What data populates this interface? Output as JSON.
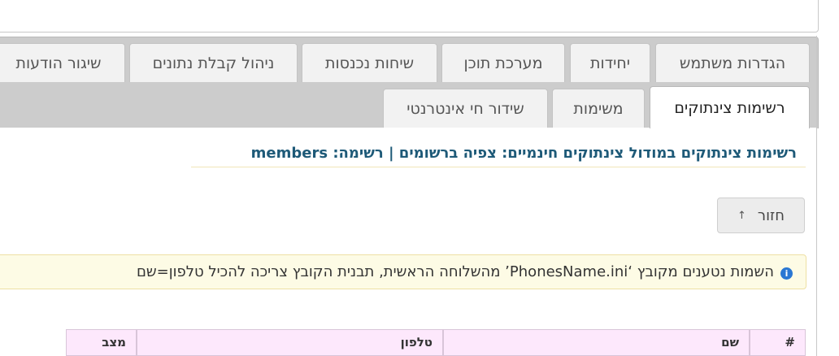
{
  "tabs_row1": [
    {
      "label": "הגדרות משתמש"
    },
    {
      "label": "יחידות"
    },
    {
      "label": "מערכת תוכן"
    },
    {
      "label": "שיחות נכנסות"
    },
    {
      "label": "ניהול קבלת נתונים"
    },
    {
      "label": "שיגור הודעות"
    }
  ],
  "tabs_row2": [
    {
      "label": "רשימות צינתוקים",
      "active": true
    },
    {
      "label": "משימות"
    },
    {
      "label": "שידור חי אינטרנטי"
    }
  ],
  "page_title": "רשימות צינתוקים במודול צינתוקים חינמיים: צפיה ברשומים | רשימה: members",
  "back_button": {
    "label": "חזור",
    "icon": "arrow-up-icon"
  },
  "alert": {
    "icon": "info-icon",
    "text": "השמות נטענים מקובץ ‘PhonesName.ini’ מהשלוחה הראשית, תבנית הקובץ צריכה להכיל טלפון=שם"
  },
  "table": {
    "columns": [
      "#",
      "שם",
      "טלפון",
      "מצב"
    ]
  },
  "colors": {
    "title": "#1e5a78",
    "tab_bar": "#cccccc",
    "alert_bg": "#fdfbe5",
    "table_header_bg": "#fde8fc",
    "info_icon": "#2a77d3"
  }
}
